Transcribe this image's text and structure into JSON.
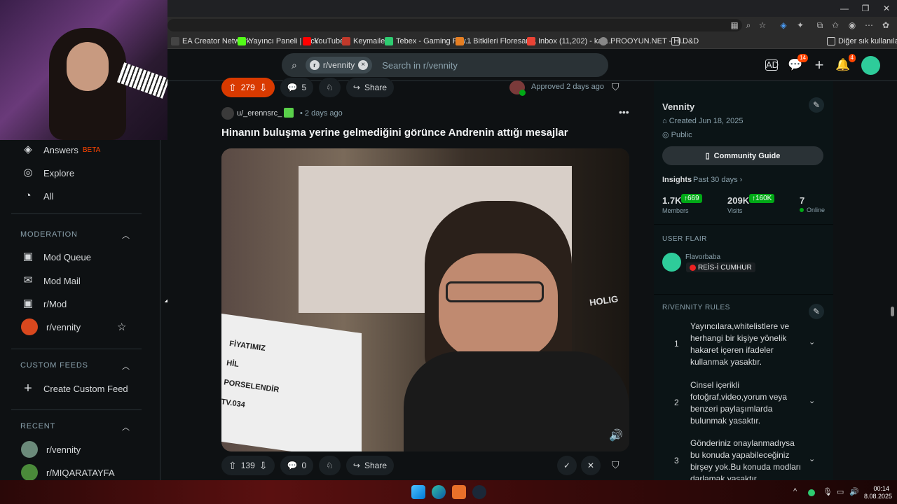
{
  "bookmarks": [
    {
      "label": "EA Creator Network",
      "color": "#444"
    },
    {
      "label": "Yayıncı Paneli | Kick",
      "color": "#53fc18"
    },
    {
      "label": "YouTube",
      "color": "#ff0000"
    },
    {
      "label": "Keymailer",
      "color": "#c0392b"
    },
    {
      "label": "Tebex - Gaming Pay...",
      "color": "#2ecc71"
    },
    {
      "label": "1 Bitkileri Floresan...",
      "color": "#e67e22"
    },
    {
      "label": "Inbox (11,202) - kaa...",
      "color": "#ea4335"
    },
    {
      "label": "PROOYUN.NET - Hi...",
      "color": "#888"
    },
    {
      "label": "D&D",
      "color": "#888"
    }
  ],
  "bookmarks_other": "Diğer sık kullanılanlar",
  "search": {
    "chip_label": "r/vennity",
    "placeholder": "Search in r/vennity"
  },
  "header_badges": {
    "chat": "14",
    "notifications": "4"
  },
  "sidebar": {
    "top_items": [
      {
        "label": "Answers",
        "tag": "BETA"
      },
      {
        "label": "Explore"
      },
      {
        "label": "All"
      }
    ],
    "moderation_title": "MODERATION",
    "moderation_items": [
      "Mod Queue",
      "Mod Mail",
      "r/Mod",
      "r/vennity"
    ],
    "custom_feeds_title": "CUSTOM FEEDS",
    "create_custom_feed": "Create Custom Feed",
    "recent_title": "RECENT",
    "recent_items": [
      "r/vennity",
      "r/MIQARATAYFA"
    ]
  },
  "prev_post": {
    "votes": "279",
    "comments": "5",
    "share": "Share",
    "approved": "Approved 2 days ago"
  },
  "post": {
    "author": "u/_erennsrc_",
    "time": "• 2 days ago",
    "title": "Hinanın buluşma yerine gelmediğini görünce Andrenin attığı mesajlar",
    "votes": "139",
    "comments": "0",
    "share": "Share",
    "image_text": [
      "FİYATIMIZ",
      "HİL",
      "PORSELENDİR",
      "TV.034"
    ],
    "bg_text": "HOLIG"
  },
  "community": {
    "name": "Vennity",
    "created": "Created Jun 18, 2025",
    "visibility": "Public",
    "guide_button": "Community Guide",
    "insights_label": "Insights",
    "insights_range": "Past 30 days",
    "members_value": "1.7K",
    "members_delta": "669",
    "members_label": "Members",
    "visits_value": "209K",
    "visits_delta": "160K",
    "visits_label": "Visits",
    "online_value": "7",
    "online_label": "Online"
  },
  "user_flair": {
    "title": "USER FLAIR",
    "username": "Flavorbaba",
    "flair": "REİS-İ CUMHUR"
  },
  "rules": {
    "title": "R/VENNITY RULES",
    "items": [
      {
        "num": "1",
        "text": "Yayıncılara,whitelistlere ve herhangi bir kişiye yönelik hakaret içeren ifadeler kullanmak yasaktır."
      },
      {
        "num": "2",
        "text": "Cinsel içerikli fotoğraf,video,yorum veya benzeri paylaşımlarda bulunmak yasaktır."
      },
      {
        "num": "3",
        "text": "Gönderiniz onaylanmadıysa bu konuda yapabileceğiniz birşey yok.Bu konuda modları darlamak yasaktır."
      }
    ]
  },
  "clock": {
    "time": "00:14",
    "date": "8.08.2025"
  },
  "colors": {
    "accent": "#d93a00",
    "online": "#01a816",
    "delta_bg": "#01a816"
  }
}
